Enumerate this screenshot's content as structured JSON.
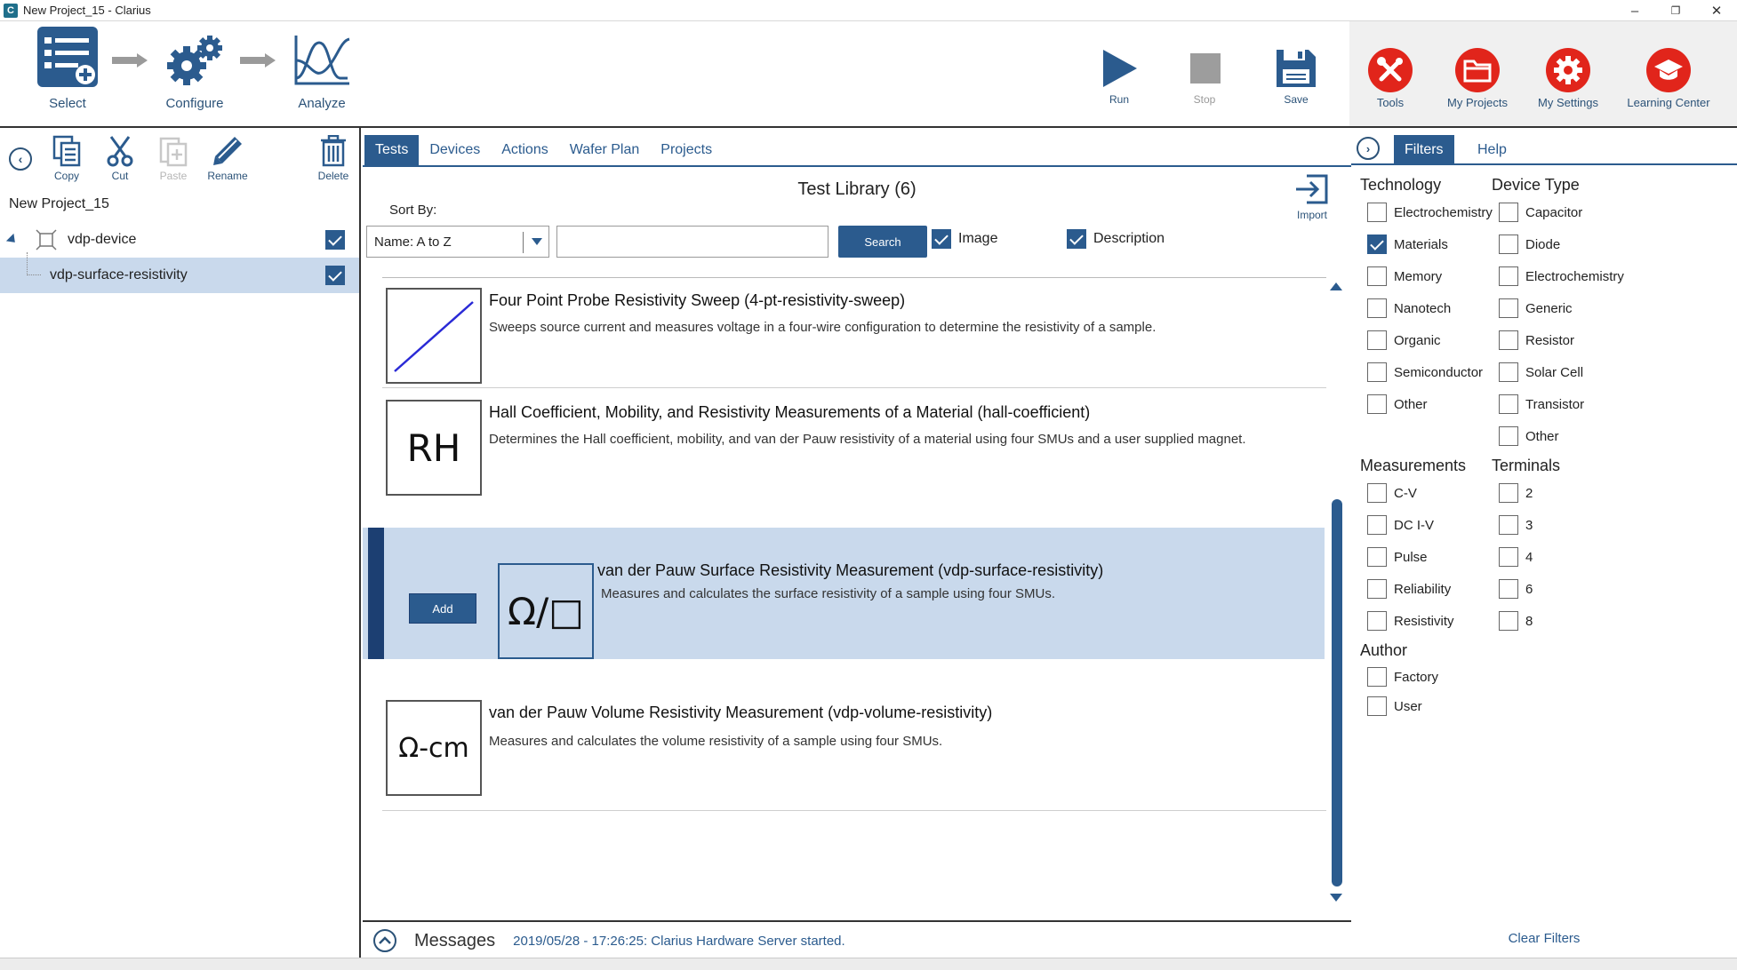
{
  "window": {
    "title": "New Project_15 - Clarius",
    "app_icon": "C",
    "controls": {
      "minimize": "–",
      "restore": "❐",
      "close": "✕"
    }
  },
  "ribbon": {
    "workflow": [
      {
        "label": "Select",
        "icon": "select-list-icon",
        "active": true
      },
      {
        "label": "Configure",
        "icon": "gears-icon",
        "active": false
      },
      {
        "label": "Analyze",
        "icon": "analyze-graph-icon",
        "active": false
      }
    ],
    "run_label": "Run",
    "stop_label": "Stop",
    "save_label": "Save",
    "tools_label": "Tools",
    "my_projects_label": "My Projects",
    "my_settings_label": "My Settings",
    "learning_center_label": "Learning Center",
    "accent_color": "#2b5278",
    "red_color": "#e1251b"
  },
  "left_panel": {
    "copy_label": "Copy",
    "cut_label": "Cut",
    "paste_label": "Paste",
    "rename_label": "Rename",
    "delete_label": "Delete",
    "project_name": "New Project_15",
    "tree": [
      {
        "label": "vdp-device",
        "checked": true,
        "selected": false
      },
      {
        "label": "vdp-surface-resistivity",
        "checked": true,
        "selected": true
      }
    ]
  },
  "center": {
    "tabs": [
      "Tests",
      "Devices",
      "Actions",
      "Wafer Plan",
      "Projects"
    ],
    "active_tab": "Tests",
    "library_title": "Test Library (6)",
    "import_label": "Import",
    "sort_by_label": "Sort By:",
    "sort_value": "Name: A to Z",
    "search_value": "",
    "search_label": "Search",
    "image_label": "Image",
    "image_checked": true,
    "description_label": "Description",
    "description_checked": true,
    "add_label": "Add",
    "tests": [
      {
        "title": "Four Point Probe Resistivity Sweep (4-pt-resistivity-sweep)",
        "description": "Sweeps source current and measures voltage in a four-wire configuration to determine the resistivity of a sample.",
        "thumb": "",
        "thumb_icon": "line-graph-icon",
        "selected": false
      },
      {
        "title": "Hall Coefficient, Mobility, and Resistivity Measurements of a Material (hall-coefficient)",
        "description": "Determines the Hall coefficient, mobility, and van der Pauw resistivity of a material using four SMUs and a user supplied magnet.",
        "thumb": "RH",
        "selected": false
      },
      {
        "title": "van der Pauw Surface Resistivity Measurement (vdp-surface-resistivity)",
        "description": "Measures and calculates the surface resistivity of a sample using four SMUs.",
        "thumb": "Ω/□",
        "selected": true
      },
      {
        "title": "van der Pauw Volume Resistivity Measurement (vdp-volume-resistivity)",
        "description": "Measures and calculates the volume resistivity of a sample using four SMUs.",
        "thumb": "Ω-cm",
        "selected": false
      }
    ],
    "messages_label": "Messages",
    "message_text": "2019/05/28 - 17:26:25: Clarius Hardware Server started."
  },
  "right_panel": {
    "tabs": [
      "Filters",
      "Help"
    ],
    "active_tab": "Filters",
    "technology": {
      "heading": "Technology",
      "options": [
        {
          "label": "Electrochemistry",
          "checked": false
        },
        {
          "label": "Materials",
          "checked": true
        },
        {
          "label": "Memory",
          "checked": false
        },
        {
          "label": "Nanotech",
          "checked": false
        },
        {
          "label": "Organic",
          "checked": false
        },
        {
          "label": "Semiconductor",
          "checked": false
        },
        {
          "label": "Other",
          "checked": false
        }
      ]
    },
    "device_type": {
      "heading": "Device Type",
      "options": [
        {
          "label": "Capacitor",
          "checked": false
        },
        {
          "label": "Diode",
          "checked": false
        },
        {
          "label": "Electrochemistry",
          "checked": false
        },
        {
          "label": "Generic",
          "checked": false
        },
        {
          "label": "Resistor",
          "checked": false
        },
        {
          "label": "Solar Cell",
          "checked": false
        },
        {
          "label": "Transistor",
          "checked": false
        },
        {
          "label": "Other",
          "checked": false
        }
      ]
    },
    "measurements": {
      "heading": "Measurements",
      "options": [
        {
          "label": "C-V",
          "checked": false
        },
        {
          "label": "DC I-V",
          "checked": false
        },
        {
          "label": "Pulse",
          "checked": false
        },
        {
          "label": "Reliability",
          "checked": false
        },
        {
          "label": "Resistivity",
          "checked": false
        }
      ]
    },
    "terminals": {
      "heading": "Terminals",
      "options": [
        {
          "label": "2",
          "checked": false
        },
        {
          "label": "3",
          "checked": false
        },
        {
          "label": "4",
          "checked": false
        },
        {
          "label": "6",
          "checked": false
        },
        {
          "label": "8",
          "checked": false
        }
      ]
    },
    "author": {
      "heading": "Author",
      "options": [
        {
          "label": "Factory",
          "checked": false
        },
        {
          "label": "User",
          "checked": false
        }
      ]
    },
    "clear_filters_label": "Clear Filters"
  }
}
